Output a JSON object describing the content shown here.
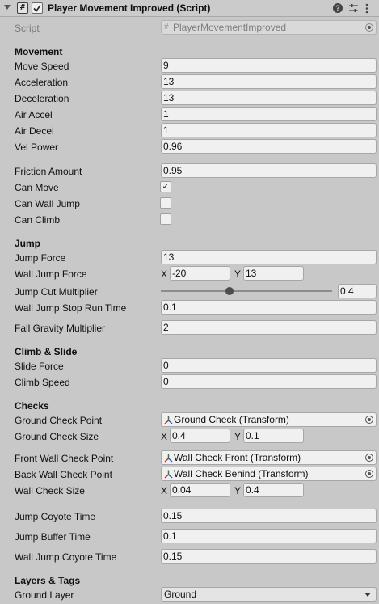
{
  "header": {
    "title": "Player Movement Improved (Script)",
    "icons": [
      "foldout-arrow-icon",
      "script-hash-icon",
      "enabled-checkbox",
      "help-icon",
      "preset-icon",
      "context-menu-icon"
    ]
  },
  "script": {
    "label": "Script",
    "value": "PlayerMovementImproved"
  },
  "movement": {
    "title": "Movement",
    "move_speed": {
      "label": "Move Speed",
      "value": "9"
    },
    "acceleration": {
      "label": "Acceleration",
      "value": "13"
    },
    "deceleration": {
      "label": "Deceleration",
      "value": "13"
    },
    "air_accel": {
      "label": "Air Accel",
      "value": "1"
    },
    "air_decel": {
      "label": "Air Decel",
      "value": "1"
    },
    "vel_power": {
      "label": "Vel Power",
      "value": "0.96"
    },
    "friction_amount": {
      "label": "Friction Amount",
      "value": "0.95"
    },
    "can_move": {
      "label": "Can Move",
      "checked": true,
      "mark": "✓"
    },
    "can_wall_jump": {
      "label": "Can Wall Jump",
      "checked": false
    },
    "can_climb": {
      "label": "Can Climb",
      "checked": false
    }
  },
  "jump": {
    "title": "Jump",
    "jump_force": {
      "label": "Jump Force",
      "value": "13"
    },
    "wall_jump_force": {
      "label": "Wall Jump Force",
      "x_label": "X",
      "x": "-20",
      "y_label": "Y",
      "y": "13"
    },
    "jump_cut_multiplier": {
      "label": "Jump Cut Multiplier",
      "value": "0.4",
      "slider_fraction": 0.4
    },
    "wall_jump_stop_run_time": {
      "label": "Wall Jump Stop Run Time",
      "value": "0.1"
    },
    "fall_gravity_multiplier": {
      "label": "Fall Gravity Multiplier",
      "value": "2"
    }
  },
  "climb_slide": {
    "title": "Climb & Slide",
    "slide_force": {
      "label": "Slide Force",
      "value": "0"
    },
    "climb_speed": {
      "label": "Climb Speed",
      "value": "0"
    }
  },
  "checks": {
    "title": "Checks",
    "ground_check_point": {
      "label": "Ground Check Point",
      "value": "Ground Check (Transform)"
    },
    "ground_check_size": {
      "label": "Ground Check Size",
      "x_label": "X",
      "x": "0.4",
      "y_label": "Y",
      "y": "0.1"
    },
    "front_wall_check_point": {
      "label": "Front Wall Check Point",
      "value": "Wall Check Front (Transform)"
    },
    "back_wall_check_point": {
      "label": "Back Wall Check Point",
      "value": "Wall Check Behind (Transform)"
    },
    "wall_check_size": {
      "label": "Wall Check Size",
      "x_label": "X",
      "x": "0.04",
      "y_label": "Y",
      "y": "0.4"
    },
    "jump_coyote_time": {
      "label": "Jump Coyote Time",
      "value": "0.15"
    },
    "jump_buffer_time": {
      "label": "Jump Buffer Time",
      "value": "0.1"
    },
    "wall_jump_coyote_time": {
      "label": "Wall Jump Coyote Time",
      "value": "0.15"
    }
  },
  "layers_tags": {
    "title": "Layers & Tags",
    "ground_layer": {
      "label": "Ground Layer",
      "value": "Ground"
    }
  },
  "colors": {
    "background": "#c8c8c8",
    "field": "#f0f0f0",
    "border": "#a7a7a7",
    "slider_thumb": "#4d4d4d"
  }
}
